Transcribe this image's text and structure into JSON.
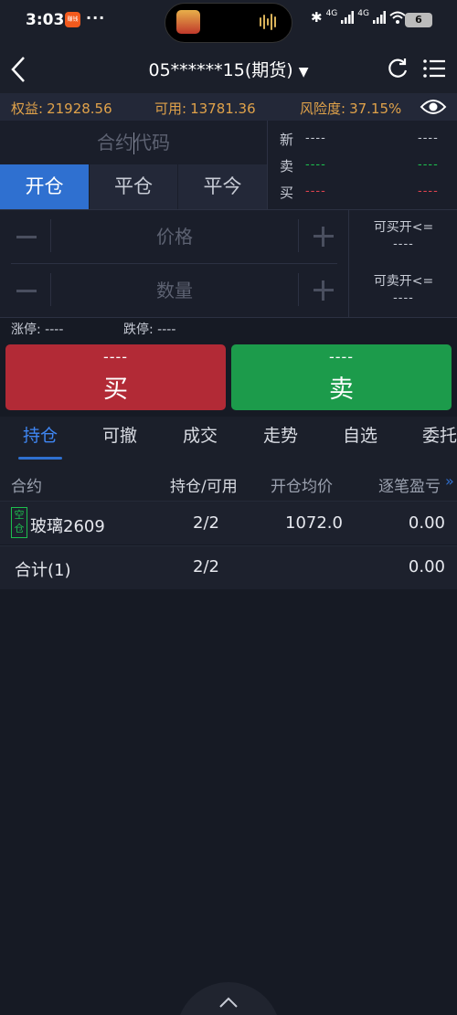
{
  "status_bar": {
    "time": "3:03",
    "app_badge": "赚钱",
    "more_dots": "···",
    "network_1": "4G",
    "network_2": "4G",
    "battery": "6",
    "icons": [
      "bluetooth-icon",
      "signal-icon",
      "signal-icon",
      "wifi-icon",
      "battery-icon"
    ]
  },
  "nav": {
    "title": "05******15(期货)",
    "icons": [
      "back-icon",
      "dropdown-icon",
      "refresh-icon",
      "menu-icon"
    ]
  },
  "account": {
    "equity_label": "权益:",
    "equity_value": "21928.56",
    "available_label": "可用:",
    "available_value": "13781.36",
    "risk_label": "风险度:",
    "risk_value": "37.15%",
    "accent_color": "#e0a24a"
  },
  "order": {
    "code_placeholder": "合约代码",
    "quote": {
      "latest_label": "新",
      "ask_label": "卖",
      "bid_label": "买",
      "latest_a": "----",
      "latest_b": "----",
      "ask_a": "----",
      "ask_b": "----",
      "bid_a": "----",
      "bid_b": "----"
    },
    "modes": [
      "开仓",
      "平仓",
      "平今"
    ],
    "active_mode": "开仓",
    "price_placeholder": "价格",
    "qty_placeholder": "数量",
    "can_buy_label": "可买开<=",
    "can_buy_value": "----",
    "can_sell_label": "可卖开<=",
    "can_sell_value": "----",
    "limit_up": "涨停: ----",
    "limit_down": "跌停: ----",
    "buy_price": "----",
    "buy_label": "买",
    "sell_price": "----",
    "sell_label": "卖",
    "buy_color": "#b22a36",
    "sell_color": "#1c9b4b"
  },
  "tabs": [
    "持仓",
    "可撤",
    "成交",
    "走势",
    "自选",
    "委托"
  ],
  "active_tab": "持仓",
  "positions": {
    "headers": [
      "合约",
      "持仓/可用",
      "开仓均价",
      "逐笔盈亏"
    ],
    "rows": [
      {
        "tag": "空仓",
        "contract": "玻璃2609",
        "hold": "2/2",
        "avg_price": "1072.0",
        "pnl": "0.00"
      }
    ],
    "total": {
      "label": "合计(1)",
      "hold": "2/2",
      "pnl": "0.00"
    }
  }
}
